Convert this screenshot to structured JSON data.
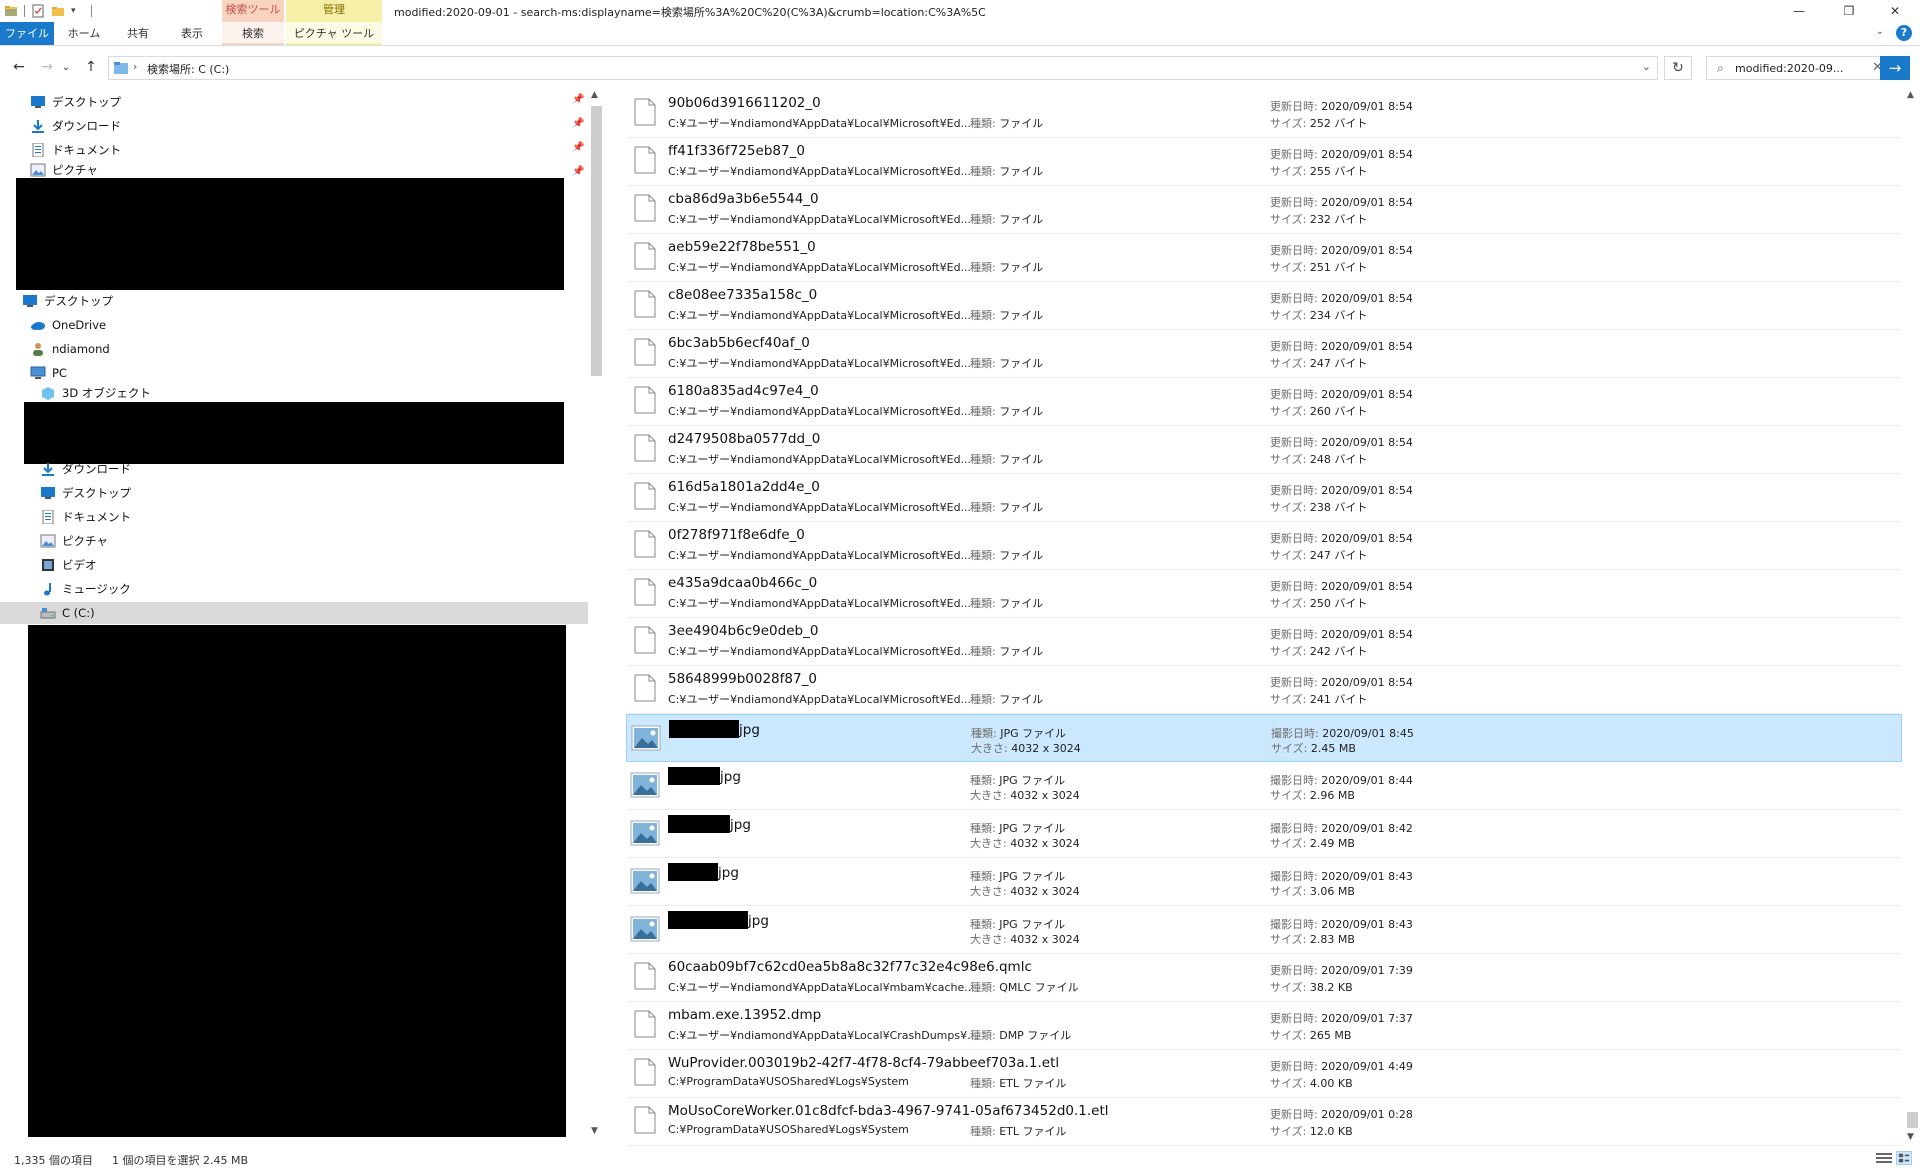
{
  "window": {
    "title": "modified:2020-09-01 - search-ms:displayname=検索場所%3A%20C%20(C%3A)&crumb=location:C%3A%5C",
    "context_search_header": "検索ツール",
    "context_manage_header": "管理",
    "minimize": "—",
    "maximize": "❐",
    "close": "✕"
  },
  "ribbon": {
    "tabs": [
      "ファイル",
      "ホーム",
      "共有",
      "表示",
      "検索",
      "ピクチャ ツール"
    ],
    "expand": "⌄",
    "help": "?"
  },
  "address": {
    "path": "検索場所: C (C:)",
    "chevron": "›",
    "dropdown": "⌄",
    "refresh": "↻",
    "back": "←",
    "forward": "→",
    "recent": "⌄",
    "up": "↑"
  },
  "search": {
    "value": "modified:2020-09...",
    "icon": "⌕",
    "clear": "✕",
    "go": "→"
  },
  "nav": {
    "quick_access": [
      {
        "label": "デスクトップ",
        "icon": "desktop-icon",
        "pinned": true
      },
      {
        "label": "ダウンロード",
        "icon": "download-icon",
        "pinned": true
      },
      {
        "label": "ドキュメント",
        "icon": "document-icon",
        "pinned": true
      },
      {
        "label": "ピクチャ",
        "icon": "picture-icon",
        "pinned": true
      }
    ],
    "tree": [
      {
        "label": "デスクトップ",
        "icon": "desktop-icon"
      },
      {
        "label": "OneDrive",
        "icon": "cloud-icon"
      },
      {
        "label": "ndiamond",
        "icon": "user-icon"
      },
      {
        "label": "PC",
        "icon": "pc-icon"
      },
      {
        "label": "3D オブジェクト",
        "icon": "cube-icon"
      }
    ],
    "pc_children": [
      {
        "label": "ダウンロード",
        "icon": "download-icon"
      },
      {
        "label": "デスクトップ",
        "icon": "desktop-icon"
      },
      {
        "label": "ドキュメント",
        "icon": "document-icon"
      },
      {
        "label": "ピクチャ",
        "icon": "picture-icon"
      },
      {
        "label": "ビデオ",
        "icon": "video-icon"
      },
      {
        "label": "ミュージック",
        "icon": "music-icon"
      },
      {
        "label": "C (C:)",
        "icon": "drive-icon",
        "selected": true
      }
    ],
    "pin_glyph": "📌"
  },
  "labels": {
    "modified": "更新日時:",
    "size": "サイズ:",
    "type": "種類:",
    "dimensions": "大きさ:",
    "taken": "撮影日時:"
  },
  "files": [
    {
      "kind": "file",
      "name": "90b06d3916611202_0",
      "path": "C:¥ユーザー¥ndiamond¥AppData¥Local¥Microsoft¥Ed...",
      "type": "ファイル",
      "date": "2020/09/01 8:54",
      "size": "252 バイト"
    },
    {
      "kind": "file",
      "name": "ff41f336f725eb87_0",
      "path": "C:¥ユーザー¥ndiamond¥AppData¥Local¥Microsoft¥Ed...",
      "type": "ファイル",
      "date": "2020/09/01 8:54",
      "size": "255 バイト"
    },
    {
      "kind": "file",
      "name": "cba86d9a3b6e5544_0",
      "path": "C:¥ユーザー¥ndiamond¥AppData¥Local¥Microsoft¥Ed...",
      "type": "ファイル",
      "date": "2020/09/01 8:54",
      "size": "232 バイト"
    },
    {
      "kind": "file",
      "name": "aeb59e22f78be551_0",
      "path": "C:¥ユーザー¥ndiamond¥AppData¥Local¥Microsoft¥Ed...",
      "type": "ファイル",
      "date": "2020/09/01 8:54",
      "size": "251 バイト"
    },
    {
      "kind": "file",
      "name": "c8e08ee7335a158c_0",
      "path": "C:¥ユーザー¥ndiamond¥AppData¥Local¥Microsoft¥Ed...",
      "type": "ファイル",
      "date": "2020/09/01 8:54",
      "size": "234 バイト"
    },
    {
      "kind": "file",
      "name": "6bc3ab5b6ecf40af_0",
      "path": "C:¥ユーザー¥ndiamond¥AppData¥Local¥Microsoft¥Ed...",
      "type": "ファイル",
      "date": "2020/09/01 8:54",
      "size": "247 バイト"
    },
    {
      "kind": "file",
      "name": "6180a835ad4c97e4_0",
      "path": "C:¥ユーザー¥ndiamond¥AppData¥Local¥Microsoft¥Ed...",
      "type": "ファイル",
      "date": "2020/09/01 8:54",
      "size": "260 バイト"
    },
    {
      "kind": "file",
      "name": "d2479508ba0577dd_0",
      "path": "C:¥ユーザー¥ndiamond¥AppData¥Local¥Microsoft¥Ed...",
      "type": "ファイル",
      "date": "2020/09/01 8:54",
      "size": "248 バイト"
    },
    {
      "kind": "file",
      "name": "616d5a1801a2dd4e_0",
      "path": "C:¥ユーザー¥ndiamond¥AppData¥Local¥Microsoft¥Ed...",
      "type": "ファイル",
      "date": "2020/09/01 8:54",
      "size": "238 バイト"
    },
    {
      "kind": "file",
      "name": "0f278f971f8e6dfe_0",
      "path": "C:¥ユーザー¥ndiamond¥AppData¥Local¥Microsoft¥Ed...",
      "type": "ファイル",
      "date": "2020/09/01 8:54",
      "size": "247 バイト"
    },
    {
      "kind": "file",
      "name": "e435a9dcaa0b466c_0",
      "path": "C:¥ユーザー¥ndiamond¥AppData¥Local¥Microsoft¥Ed...",
      "type": "ファイル",
      "date": "2020/09/01 8:54",
      "size": "250 バイト"
    },
    {
      "kind": "file",
      "name": "3ee4904b6c9e0deb_0",
      "path": "C:¥ユーザー¥ndiamond¥AppData¥Local¥Microsoft¥Ed...",
      "type": "ファイル",
      "date": "2020/09/01 8:54",
      "size": "242 バイト"
    },
    {
      "kind": "file",
      "name": "58648999b0028f87_0",
      "path": "C:¥ユーザー¥ndiamond¥AppData¥Local¥Microsoft¥Ed...",
      "type": "ファイル",
      "date": "2020/09/01 8:54",
      "size": "241 バイト"
    },
    {
      "kind": "photo",
      "name_suffix": "jpg",
      "type": "JPG ファイル",
      "dimensions": "4032 x 3024",
      "date": "2020/09/01 8:45",
      "size": "2.45 MB",
      "selected": true
    },
    {
      "kind": "photo",
      "name_suffix": "jpg",
      "type": "JPG ファイル",
      "dimensions": "4032 x 3024",
      "date": "2020/09/01 8:44",
      "size": "2.96 MB"
    },
    {
      "kind": "photo",
      "name_suffix": "jpg",
      "type": "JPG ファイル",
      "dimensions": "4032 x 3024",
      "date": "2020/09/01 8:42",
      "size": "2.49 MB"
    },
    {
      "kind": "photo",
      "name_suffix": "jpg",
      "type": "JPG ファイル",
      "dimensions": "4032 x 3024",
      "date": "2020/09/01 8:43",
      "size": "3.06 MB"
    },
    {
      "kind": "photo",
      "name_suffix": "jpg",
      "type": "JPG ファイル",
      "dimensions": "4032 x 3024",
      "date": "2020/09/01 8:43",
      "size": "2.83 MB"
    },
    {
      "kind": "file",
      "name": "60caab09bf7c62cd0ea5b8a8c32f77c32e4c98e6.qmlc",
      "path": "C:¥ユーザー¥ndiamond¥AppData¥Local¥mbam¥cache...",
      "type": "QMLC ファイル",
      "date": "2020/09/01 7:39",
      "size": "38.2 KB"
    },
    {
      "kind": "file",
      "name": "mbam.exe.13952.dmp",
      "path": "C:¥ユーザー¥ndiamond¥AppData¥Local¥CrashDumps¥...",
      "type": "DMP ファイル",
      "date": "2020/09/01 7:37",
      "size": "265 MB"
    },
    {
      "kind": "file",
      "name": "WuProvider.003019b2-42f7-4f78-8cf4-79abbeef703a.1.etl",
      "path": "C:¥ProgramData¥USOShared¥Logs¥System",
      "type": "ETL ファイル",
      "date": "2020/09/01 4:49",
      "size": "4.00 KB"
    },
    {
      "kind": "file",
      "name": "MoUsoCoreWorker.01c8dfcf-bda3-4967-9741-05af673452d0.1.etl",
      "path": "C:¥ProgramData¥USOShared¥Logs¥System",
      "type": "ETL ファイル",
      "date": "2020/09/01 0:28",
      "size": "12.0 KB"
    }
  ],
  "status": {
    "count": "1,335 個の項目",
    "selected": "1 個の項目を選択  2.45 MB"
  },
  "colors": {
    "accent": "#1979ca",
    "selection": "#cce8ff",
    "search_tools_tab": "#f7d3c0",
    "picture_tools_tab": "#f5efa8"
  }
}
